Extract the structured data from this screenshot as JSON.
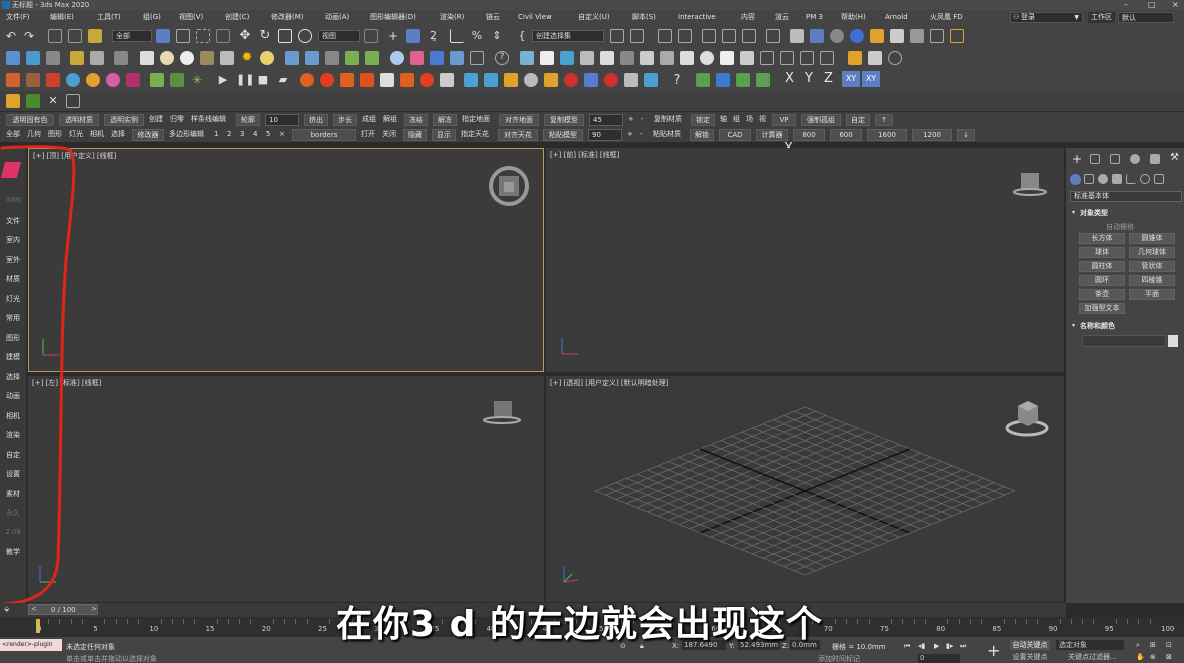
{
  "window": {
    "title": "无标题 - 3ds Max 2020"
  },
  "menu": {
    "items": [
      "文件(F)",
      "编辑(E)",
      "工具(T)",
      "组(G)",
      "视图(V)",
      "创建(C)",
      "修改器(M)",
      "动画(A)",
      "图形编辑器(D)",
      "渲染(R)",
      "链云",
      "Civil View",
      "自定义(U)",
      "脚本(S)",
      "Interactive",
      "内容",
      "渲云",
      "PM 3",
      "帮助(H)",
      "Arnold",
      "火凤凰 FD"
    ],
    "login": "登录",
    "workspace_label": "工作区",
    "workspace_value": "默认"
  },
  "toolbar": {
    "selection_filter": "全部",
    "view_dropdown": "视图",
    "selection_set": "创建选择集"
  },
  "axis_buttons": [
    "X",
    "Y",
    "Z",
    "XY",
    "XY"
  ],
  "command_rows": {
    "row1": [
      {
        "label": "透明固有色",
        "kind": "btn"
      },
      {
        "label": "透明材质",
        "kind": "btn"
      },
      {
        "label": "透明实例",
        "kind": "btn"
      },
      {
        "label": "创建",
        "kind": "text"
      },
      {
        "label": "归零",
        "kind": "text"
      },
      {
        "label": "样条线编辑",
        "kind": "text"
      },
      {
        "label": "轮廓",
        "kind": "btn"
      },
      {
        "label": "10",
        "kind": "spin"
      },
      {
        "label": "挤出",
        "kind": "btn"
      },
      {
        "label": "步长",
        "kind": "btn"
      },
      {
        "label": "成组",
        "kind": "text"
      },
      {
        "label": "解组",
        "kind": "text"
      },
      {
        "label": "冻结",
        "kind": "btn"
      },
      {
        "label": "解冻",
        "kind": "btn"
      },
      {
        "label": "指定地面",
        "kind": "text"
      },
      {
        "label": "对齐地面",
        "kind": "btn"
      },
      {
        "label": "复制模型",
        "kind": "btn"
      },
      {
        "label": "45",
        "kind": "spin"
      },
      {
        "label": "+",
        "kind": "text"
      },
      {
        "label": "-",
        "kind": "text"
      },
      {
        "label": "复制材质",
        "kind": "text"
      },
      {
        "label": "锁定",
        "kind": "btn"
      },
      {
        "label": "轴",
        "kind": "text"
      },
      {
        "label": "组",
        "kind": "text"
      },
      {
        "label": "场",
        "kind": "text"
      },
      {
        "label": "视",
        "kind": "text"
      },
      {
        "label": "VP",
        "kind": "btn"
      },
      {
        "label": "强制孤组",
        "kind": "btn"
      },
      {
        "label": "自定",
        "kind": "btn"
      },
      {
        "label": "↑",
        "kind": "btn"
      }
    ],
    "row2": [
      {
        "label": "全部",
        "kind": "text"
      },
      {
        "label": "几何",
        "kind": "text"
      },
      {
        "label": "图形",
        "kind": "text"
      },
      {
        "label": "灯光",
        "kind": "text"
      },
      {
        "label": "相机",
        "kind": "text"
      },
      {
        "label": "选择",
        "kind": "text"
      },
      {
        "label": "修改器",
        "kind": "btn"
      },
      {
        "label": "多边形编辑",
        "kind": "text"
      },
      {
        "label": "1",
        "kind": "text"
      },
      {
        "label": "2",
        "kind": "text"
      },
      {
        "label": "3",
        "kind": "text"
      },
      {
        "label": "4",
        "kind": "text"
      },
      {
        "label": "5",
        "kind": "text"
      },
      {
        "label": "×",
        "kind": "text"
      },
      {
        "label": "borders",
        "kind": "btn"
      },
      {
        "label": "打开",
        "kind": "text"
      },
      {
        "label": "关闭",
        "kind": "text"
      },
      {
        "label": "隐藏",
        "kind": "btn"
      },
      {
        "label": "显示",
        "kind": "btn"
      },
      {
        "label": "指定天花",
        "kind": "text"
      },
      {
        "label": "对齐天花",
        "kind": "btn"
      },
      {
        "label": "粘贴模型",
        "kind": "btn"
      },
      {
        "label": "90",
        "kind": "spin"
      },
      {
        "label": "+",
        "kind": "text"
      },
      {
        "label": "-",
        "kind": "text"
      },
      {
        "label": "粘贴材质",
        "kind": "text"
      },
      {
        "label": "解锁",
        "kind": "btn"
      },
      {
        "label": "CAD",
        "kind": "btn"
      },
      {
        "label": "计算器",
        "kind": "btn"
      },
      {
        "label": "800",
        "kind": "btn"
      },
      {
        "label": "600",
        "kind": "btn"
      },
      {
        "label": "1600",
        "kind": "btn"
      },
      {
        "label": "1200",
        "kind": "btn"
      },
      {
        "label": "↓",
        "kind": "btn"
      }
    ]
  },
  "left_panel": {
    "items": [
      {
        "label": "XIMI",
        "dim": true
      },
      {
        "label": "文件",
        "dim": false
      },
      {
        "label": "室内",
        "dim": false
      },
      {
        "label": "室外",
        "dim": false
      },
      {
        "label": "材质",
        "dim": false
      },
      {
        "label": "灯光",
        "dim": false
      },
      {
        "label": "常用",
        "dim": false
      },
      {
        "label": "图形",
        "dim": false
      },
      {
        "label": "建模",
        "dim": false
      },
      {
        "label": "选择",
        "dim": false
      },
      {
        "label": "动画",
        "dim": false
      },
      {
        "label": "相机",
        "dim": false
      },
      {
        "label": "渲染",
        "dim": false
      },
      {
        "label": "自定",
        "dim": false
      },
      {
        "label": "设置",
        "dim": false
      },
      {
        "label": "素材",
        "dim": false
      },
      {
        "label": "永久",
        "dim": true
      },
      {
        "label": "2.08",
        "dim": true
      },
      {
        "label": "教学",
        "dim": false
      }
    ]
  },
  "viewports": {
    "top_left": {
      "label": "[+] [顶] [用户定义] [线框]"
    },
    "top_right": {
      "label": "[+] [前] [标准] [线框]"
    },
    "bottom_left": {
      "label": "[+] [左] [标准] [线框]"
    },
    "bottom_right": {
      "label": "[+] [透视] [用户定义] [默认明暗处理]"
    }
  },
  "command_panel": {
    "dropdown": "标准基本体",
    "section_object_type": "对象类型",
    "autogrid": "自动栅格",
    "primitives": [
      "长方体",
      "圆锥体",
      "球体",
      "几何球体",
      "圆柱体",
      "管状体",
      "圆环",
      "四棱锥",
      "茶壶",
      "平面",
      "加强型文本"
    ],
    "section_name_color": "名称和颜色"
  },
  "timeline": {
    "frame": "0 / 100"
  },
  "ruler": {
    "ticks": [
      "0",
      "5",
      "10",
      "15",
      "20",
      "25",
      "30",
      "35",
      "40",
      "45",
      "50",
      "55",
      "60",
      "65",
      "70",
      "75",
      "80",
      "85",
      "90",
      "95",
      "100"
    ]
  },
  "status": {
    "script_field": "<render>-plugin",
    "selection": "未选定任何对象",
    "hint": "单击或单击并拖动以选择对象",
    "x_value": "187.6490",
    "y_value": "52.493mm",
    "z_value": "0.0mm",
    "grid": "栅格 = 10.0mm",
    "add_time_tag": "添加时间标记",
    "auto_key": "自动关键点",
    "set_key": "设置关键点",
    "selected_set": "选定对象",
    "key_filter": "关键点过滤器...",
    "frame_value": "0"
  },
  "subtitle": "在你3 d 的左边就会出现这个",
  "colors": {
    "accent": "#5b7fc2",
    "annotation": "#e0261b",
    "active_viewport": "#b89a55"
  }
}
